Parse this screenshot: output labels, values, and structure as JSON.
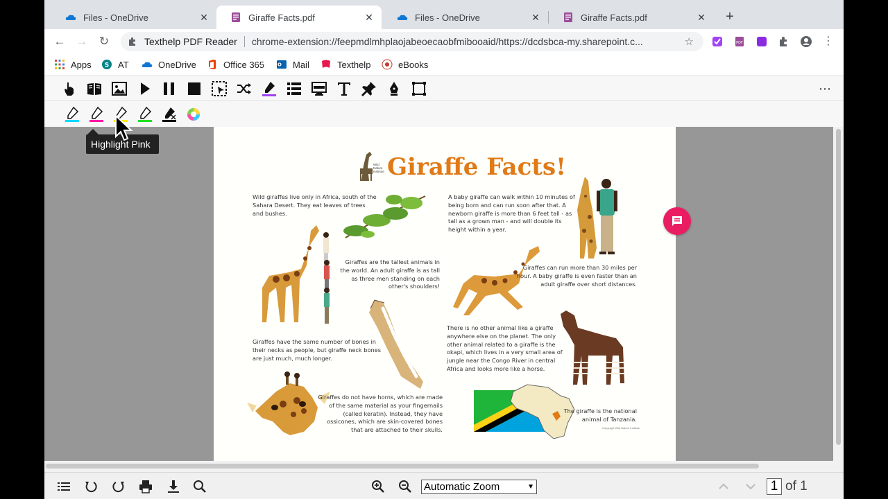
{
  "tabs": [
    {
      "label": "Files - OneDrive",
      "icon": "onedrive-icon",
      "active": false
    },
    {
      "label": "Giraffe Facts.pdf",
      "icon": "pdf-icon",
      "active": true
    },
    {
      "label": "Files - OneDrive",
      "icon": "onedrive-icon",
      "active": false
    },
    {
      "label": "Giraffe Facts.pdf",
      "icon": "pdf-icon",
      "active": false
    }
  ],
  "address": {
    "extension_name": "Texthelp PDF Reader",
    "url": "chrome-extension://feepmdlmhplaojabeoecaobfmibooaid/https://dcdsbca-my.sharepoint.c..."
  },
  "bookmarks": [
    {
      "label": "Apps",
      "icon": "apps-grid-icon"
    },
    {
      "label": "AT",
      "icon": "sharepoint-icon"
    },
    {
      "label": "OneDrive",
      "icon": "onedrive-icon"
    },
    {
      "label": "Office 365",
      "icon": "office-icon"
    },
    {
      "label": "Mail",
      "icon": "outlook-icon"
    },
    {
      "label": "Texthelp",
      "icon": "texthelp-icon"
    },
    {
      "label": "eBooks",
      "icon": "ebooks-icon"
    }
  ],
  "tooltip": "Highlight Pink",
  "pdf": {
    "title": "Giraffe Facts!",
    "logo_text": "Wild Nature Institute",
    "credit": "Copyright Wild Nature Institute",
    "facts": [
      "Wild giraffes live only in Africa, south of the Sahara Desert.  They eat leaves of trees and bushes.",
      "A baby giraffe can walk within 10 minutes of being born and can run soon after that. A newborn giraffe is more than 6 feet tall - as tall as a grown man - and will double its height within a year.",
      "Giraffes are the tallest animals in the world.  An adult giraffe is as tall as three men standing on each other's shoulders!",
      "Giraffes can run more than 30 miles per hour.  A baby giraffe is even faster than an adult giraffe over short distances.",
      "There is no other animal like a giraffe anywhere else on the planet.  The only other animal related to a giraffe is the okapi, which lives in a very small area of jungle near the Congo River in central Africa and looks more like a horse.",
      "Giraffes have the same number of bones in their necks as people, but giraffe neck bones are just much, much longer.",
      "Giraffes do not have horns, which are made of the same material as your fingernails (called keratin).  Instead, they have ossicones, which are skin-covered bones that are attached to their skulls.",
      "The giraffe is the national animal of Tanzania."
    ]
  },
  "pdf_toolbar": {
    "zoom": "Automatic Zoom",
    "page_current": "1",
    "page_total": "of 1"
  },
  "colors": {
    "accent_pink": "#ea1d63",
    "title_orange": "#e07a16",
    "highlight_active": "#a142f4"
  }
}
